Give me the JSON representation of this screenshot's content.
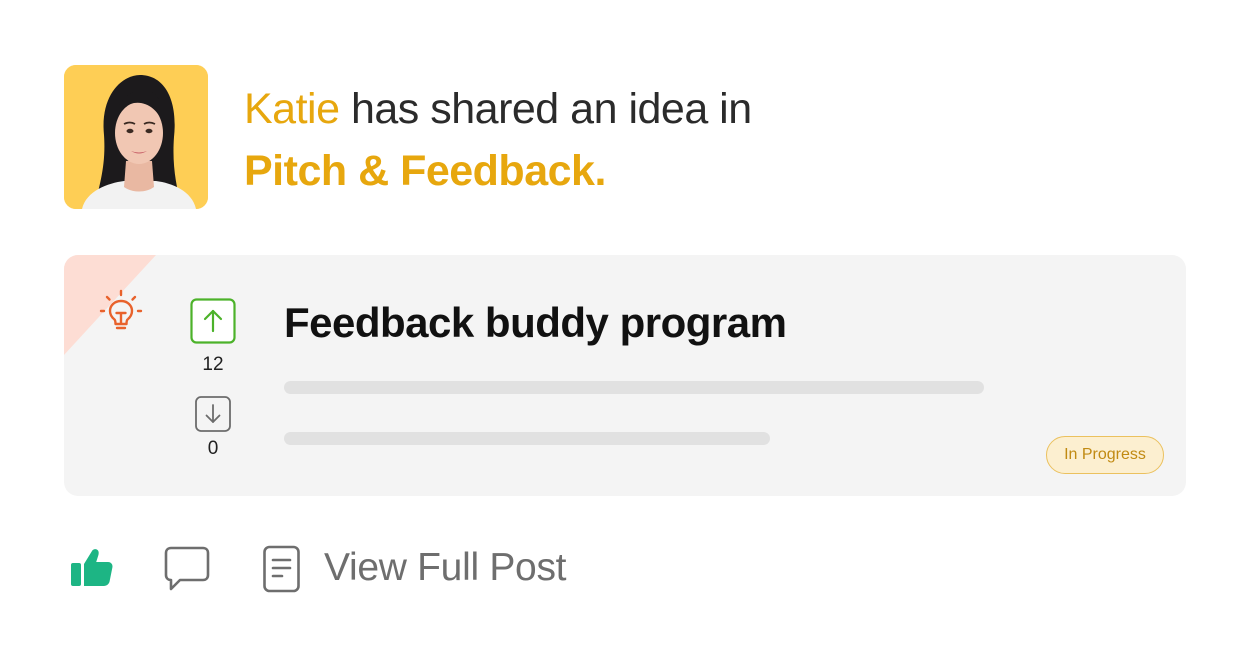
{
  "header": {
    "user_name": "Katie",
    "action_text": " has shared an idea in",
    "community_name": "Pitch & Feedback."
  },
  "idea": {
    "category_icon": "lightbulb-icon",
    "title": "Feedback buddy program",
    "upvotes": "12",
    "downvotes": "0",
    "status": "In Progress"
  },
  "actions": {
    "like_icon": "thumbs-up-icon",
    "comment_icon": "comment-icon",
    "view_icon": "document-icon",
    "view_label": "View Full Post"
  },
  "colors": {
    "accent": "#E7A70E",
    "upvote_green": "#4CB22A",
    "like_green": "#1DB584",
    "bulb_orange": "#E8622C",
    "status_text": "#C18A12",
    "card_bg": "#F4F4F4"
  }
}
